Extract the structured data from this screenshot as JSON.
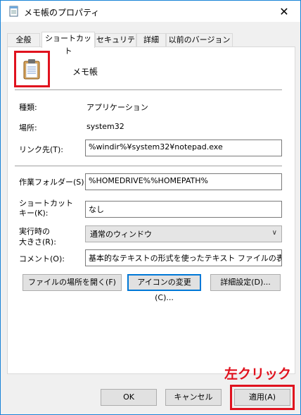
{
  "window": {
    "title": "メモ帳のプロパティ",
    "close_glyph": "✕"
  },
  "tabs": [
    {
      "label": "全般"
    },
    {
      "label": "ショートカット"
    },
    {
      "label": "セキュリティ"
    },
    {
      "label": "詳細"
    },
    {
      "label": "以前のバージョン"
    }
  ],
  "shortcut": {
    "name": "メモ帳",
    "type_label": "種類:",
    "type_value": "アプリケーション",
    "location_label": "場所:",
    "location_value": "system32",
    "target_label": "リンク先(T):",
    "target_value": "%windir%¥system32¥notepad.exe",
    "workdir_label": "作業フォルダー(S):",
    "workdir_value": "%HOMEDRIVE%%HOMEPATH%",
    "hotkey_label_line1": "ショートカット",
    "hotkey_label_line2": "キー(K):",
    "hotkey_value": "なし",
    "run_label_line1": "実行時の",
    "run_label_line2": "大きさ(R):",
    "run_value": "通常のウィンドウ",
    "comment_label": "コメント(O):",
    "comment_value": "基本的なテキストの形式を使ったテキスト ファイルの表示と編",
    "open_location_button": "ファイルの場所を開く(F)",
    "change_icon_button": "アイコンの変更(C)...",
    "advanced_button": "詳細設定(D)..."
  },
  "footer": {
    "ok_button": "OK",
    "cancel_button": "キャンセル",
    "apply_button": "適用(A)"
  },
  "annotation": {
    "text": "左クリック",
    "color": "#e0121e"
  }
}
